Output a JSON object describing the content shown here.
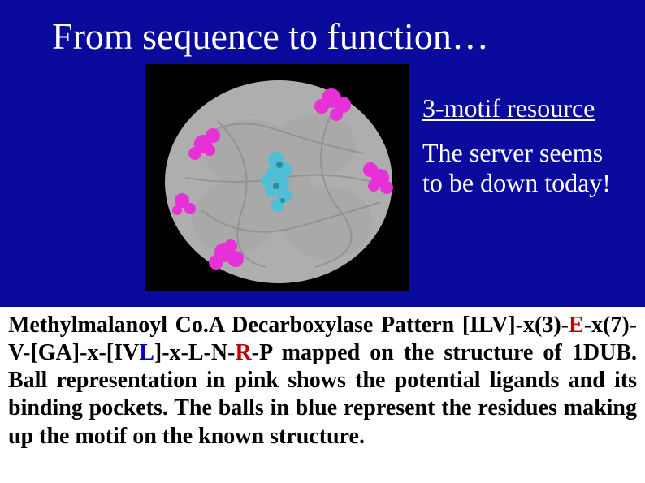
{
  "title": "From sequence to function…",
  "side": {
    "link_label": "3-motif resource",
    "note_line1": "The server seems",
    "note_line2": "to be down today!"
  },
  "caption": {
    "lead": "Methylmalanoyl Co.A Decarboxylase  Pattern",
    "pattern_part1": " [ILV]-x(3)-",
    "pattern_E": "E",
    "pattern_part2": "-x(7)-V-[GA]-x-[IV",
    "pattern_L": "L",
    "pattern_part3": "]-x-L-N-",
    "pattern_R": "R",
    "pattern_part4": "-P",
    "rest": " mapped on the structure of 1DUB. Ball representation in pink shows the potential ligands and its binding pockets. The balls in blue represent the residues making up the motif on the known structure."
  },
  "colors": {
    "background": "#0a0a9c",
    "highlight_pink": "#e830d8",
    "highlight_cyan": "#4fbfd6",
    "ribbon_gray": "#bdbdbd"
  },
  "image_semantic": "protein-structure-1DUB-motif"
}
